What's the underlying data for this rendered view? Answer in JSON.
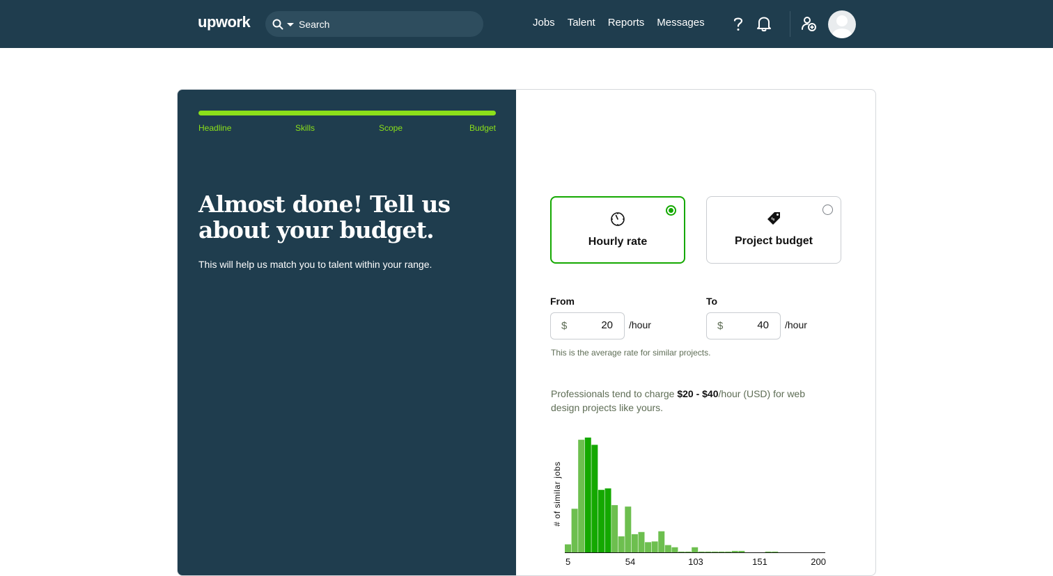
{
  "header": {
    "logo": "upwork",
    "search_placeholder": "Search",
    "nav": [
      "Jobs",
      "Talent",
      "Reports",
      "Messages"
    ]
  },
  "progress": {
    "steps": [
      "Headline",
      "Skills",
      "Scope",
      "Budget"
    ],
    "value": 1.0
  },
  "intro": {
    "headline": "Almost done! Tell us about your budget.",
    "subtext": "This will help us match you to talent within your range."
  },
  "budget_type": {
    "options": [
      {
        "label": "Hourly rate",
        "icon": "clock-icon",
        "selected": true
      },
      {
        "label": "Project budget",
        "icon": "price-tag-icon",
        "selected": false
      }
    ]
  },
  "rate": {
    "from_label": "From",
    "to_label": "To",
    "currency": "$",
    "from_value": "20",
    "to_value": "40",
    "unit": "/hour",
    "note": "This is the average rate for similar projects."
  },
  "insight": {
    "prefix": "Professionals tend to charge ",
    "range": "$20 - $40",
    "suffix": "/hour (USD) for web design projects like yours."
  },
  "colors": {
    "header_bg": "#1f3d4e",
    "accent_lime": "#8be01a",
    "accent_green": "#14a800",
    "bar_dark": "#14a800",
    "bar_light": "#6dbf4f"
  },
  "chart_data": {
    "type": "bar",
    "ylabel": "# of similar jobs",
    "xlabel": "",
    "x_ticks": [
      5,
      54,
      103,
      151,
      200
    ],
    "bin_edges": [
      5,
      10,
      15,
      20,
      25,
      30,
      35,
      40,
      45,
      50,
      55,
      60,
      65,
      70,
      75,
      80,
      85,
      90,
      95,
      100,
      105,
      110,
      115,
      120,
      125,
      130,
      135,
      140,
      145,
      150,
      155,
      160,
      165,
      170,
      175,
      180,
      185,
      190,
      195,
      200
    ],
    "values": [
      11,
      60,
      155,
      158,
      148,
      86,
      88,
      65,
      22,
      63,
      25,
      28,
      14,
      15,
      29,
      10,
      7,
      1,
      1,
      7,
      1,
      1,
      1,
      1,
      1,
      2,
      2,
      0,
      0,
      0,
      1,
      1,
      0,
      0,
      0,
      0,
      0,
      0,
      0
    ],
    "highlight_range": [
      20,
      40
    ],
    "grid": false
  }
}
